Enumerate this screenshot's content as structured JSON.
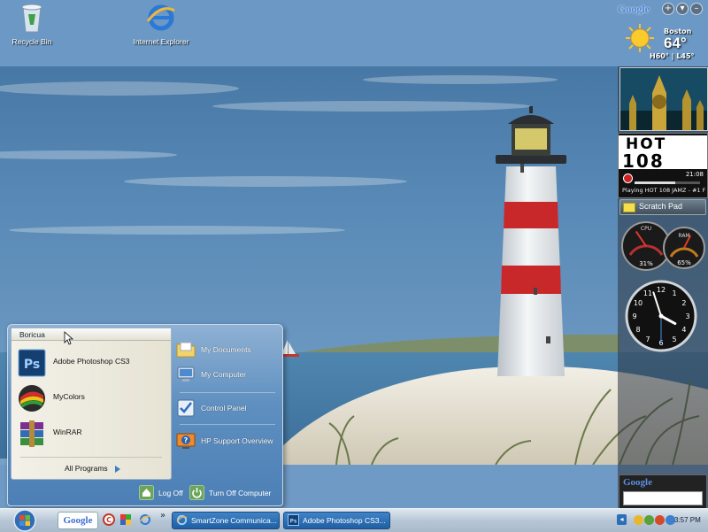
{
  "desktop": {
    "icons": [
      {
        "label": "Recycle Bin",
        "icon": "recycle-bin-icon"
      },
      {
        "label": "Internet Explorer",
        "icon": "internet-explorer-icon"
      }
    ]
  },
  "gadgets": {
    "google_toolbar": {
      "logo": "Google",
      "buttons": [
        "+",
        "▾",
        "–"
      ]
    },
    "weather": {
      "city": "Boston",
      "temperature": "64°",
      "hilo": "H60° | L45°",
      "icon": "sun-icon"
    },
    "radio": {
      "logo_line1": "HOT",
      "logo_line2": "108",
      "time": "21:08",
      "progress": 0.62,
      "now_playing": "Playing HOT 108 JAMZ - #1 FC"
    },
    "scratch_pad": {
      "label": "Scratch Pad"
    },
    "cpu_meter": {
      "cpu_label": "CPU",
      "ram_label": "RAM",
      "cpu_value": "31%",
      "ram_value": "65%",
      "cpu_percent": 31,
      "ram_percent": 65
    },
    "clock": {
      "hour": 3,
      "minute": 57,
      "second": 30
    },
    "google_search": {
      "logo": "Google"
    }
  },
  "start_menu": {
    "user": "Boricua",
    "pinned": [
      {
        "label": "Adobe Photoshop CS3",
        "icon": "photoshop-icon"
      },
      {
        "label": "MyColors",
        "icon": "mycolors-icon"
      },
      {
        "label": "WinRAR",
        "icon": "winrar-icon"
      }
    ],
    "all_programs": "All Programs",
    "right_items": [
      {
        "label": "My Documents",
        "icon": "folder-icon"
      },
      {
        "label": "My Computer",
        "icon": "computer-icon"
      },
      {
        "label": "Control Panel",
        "icon": "control-panel-icon"
      },
      {
        "label": "HP Support Overview",
        "icon": "help-icon"
      }
    ],
    "log_off": "Log Off",
    "turn_off": "Turn Off Computer"
  },
  "taskbar": {
    "quick_launch": {
      "google": "Google",
      "more": "»"
    },
    "tasks": [
      {
        "label": "SmartZone Communica...",
        "icon": "internet-explorer-icon"
      },
      {
        "label": "Adobe Photoshop CS3...",
        "icon": "photoshop-icon"
      }
    ],
    "clock": "3:57 PM"
  },
  "colors": {
    "sky": "#5b88b3",
    "sea": "#4f7fa8",
    "sand": "#e9e4d6",
    "lighthouse_red": "#c8282a",
    "taskbar": "#b7c6d6",
    "task_button": "#2f72b8"
  }
}
